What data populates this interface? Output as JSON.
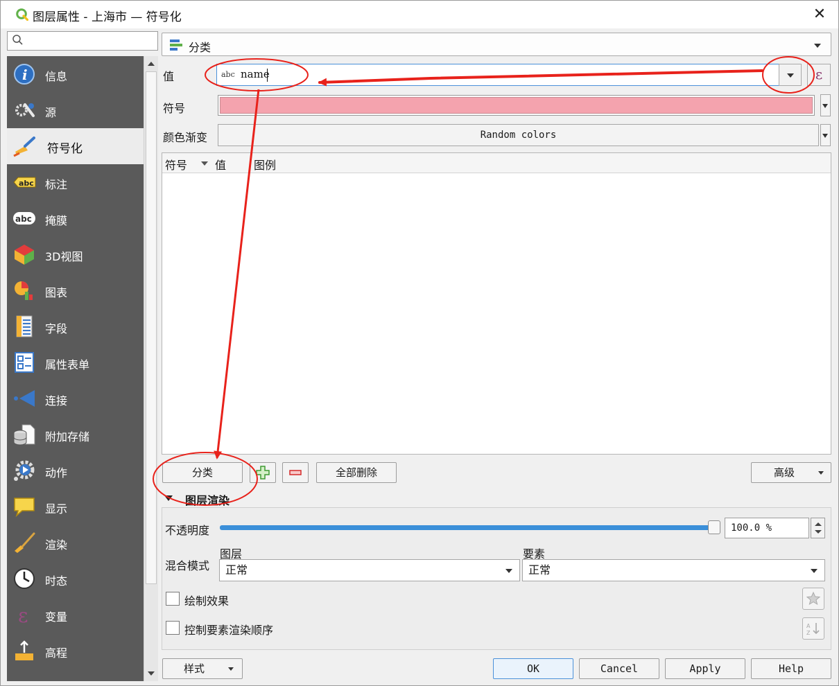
{
  "window": {
    "title": "图层属性 - 上海市 — 符号化",
    "close_glyph": "✕"
  },
  "sidebar": {
    "search_placeholder": "",
    "items": [
      {
        "label": "信息",
        "icon": "info-icon"
      },
      {
        "label": "源",
        "icon": "source-wrench-icon"
      },
      {
        "label": "符号化",
        "icon": "symbology-brush-icon",
        "active": true
      },
      {
        "label": "标注",
        "icon": "labels-abc-icon"
      },
      {
        "label": "掩膜",
        "icon": "mask-abc-icon"
      },
      {
        "label": "3D视图",
        "icon": "3d-cube-icon"
      },
      {
        "label": "图表",
        "icon": "diagram-icon"
      },
      {
        "label": "字段",
        "icon": "fields-icon"
      },
      {
        "label": "属性表单",
        "icon": "attribute-form-icon"
      },
      {
        "label": "连接",
        "icon": "joins-icon"
      },
      {
        "label": "附加存储",
        "icon": "auxiliary-storage-icon"
      },
      {
        "label": "动作",
        "icon": "actions-gear-icon"
      },
      {
        "label": "显示",
        "icon": "display-bubble-icon"
      },
      {
        "label": "渲染",
        "icon": "rendering-brush-icon"
      },
      {
        "label": "时态",
        "icon": "temporal-clock-icon"
      },
      {
        "label": "变量",
        "icon": "variables-epsilon-icon"
      },
      {
        "label": "高程",
        "icon": "elevation-icon"
      }
    ]
  },
  "renderer": {
    "label": "分类"
  },
  "value_field": {
    "label": "值",
    "type_badge": "abc",
    "value": "name",
    "expression_glyph": "ε"
  },
  "symbol": {
    "label": "符号",
    "color": "#f4a3ae"
  },
  "color_ramp": {
    "label": "颜色渐变",
    "value": "Random colors"
  },
  "table": {
    "columns": [
      "符号",
      "值",
      "图例"
    ],
    "rows": []
  },
  "classify_buttons": {
    "classify": "分类",
    "delete_all": "全部删除",
    "advanced": "高级"
  },
  "layer_rendering": {
    "title": "图层渲染",
    "opacity_label": "不透明度",
    "opacity_value": "100.0 %",
    "opacity_fraction": 1.0,
    "blend_mode_label": "混合模式",
    "layer_label": "图层",
    "layer_blend": "正常",
    "feature_label": "要素",
    "feature_blend": "正常",
    "draw_effects": "绘制效果",
    "control_order": "控制要素渲染顺序"
  },
  "footer": {
    "style": "样式",
    "ok": "OK",
    "cancel": "Cancel",
    "apply": "Apply",
    "help": "Help"
  },
  "colors": {
    "annotation": "#e8221b",
    "accent": "#3b8fd9",
    "sidebar_bg": "#5a5a5a"
  }
}
